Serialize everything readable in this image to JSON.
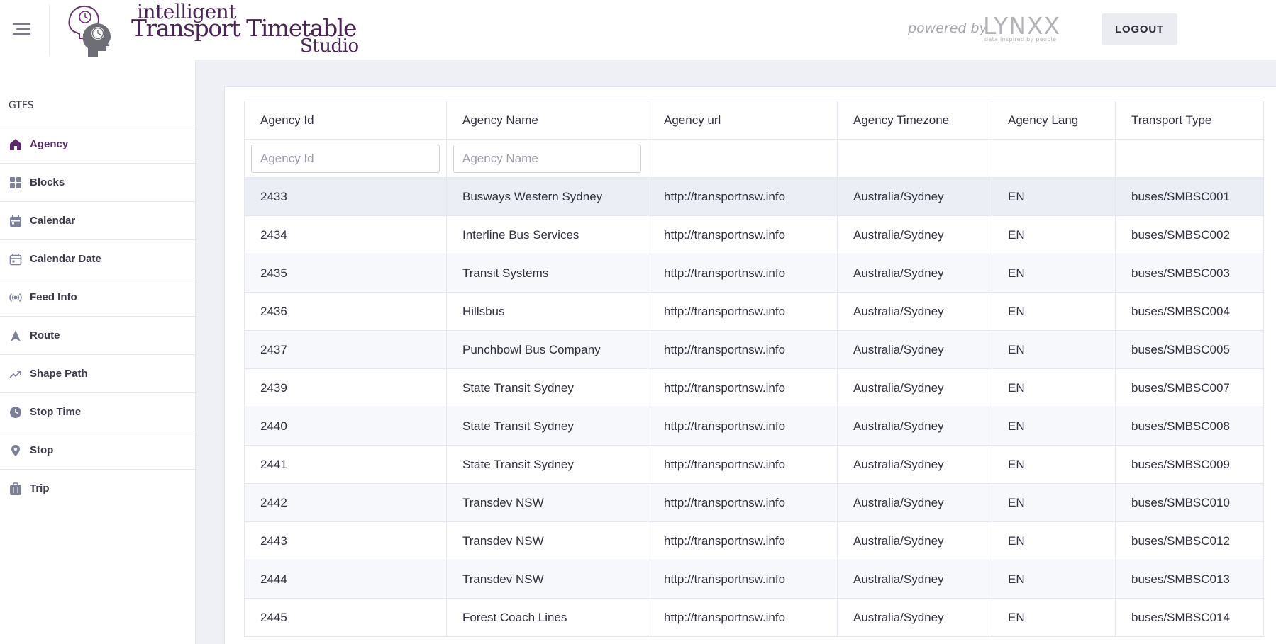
{
  "header": {
    "brand_line1": "intelligent",
    "brand_line2": "Transport Timetable",
    "brand_line3": "Studio",
    "powered_by": "powered by",
    "partner_logo": "LYNXX",
    "partner_tagline": "data inspired by people",
    "logout_label": "LOGOUT"
  },
  "sidebar": {
    "title": "GTFS",
    "items": [
      {
        "label": "Agency",
        "icon": "home-icon",
        "active": true
      },
      {
        "label": "Blocks",
        "icon": "grid-icon"
      },
      {
        "label": "Calendar",
        "icon": "calendar-icon"
      },
      {
        "label": "Calendar Date",
        "icon": "calendar-outline-icon"
      },
      {
        "label": "Feed Info",
        "icon": "broadcast-icon"
      },
      {
        "label": "Route",
        "icon": "navigation-arrow-icon"
      },
      {
        "label": "Shape Path",
        "icon": "trending-up-icon"
      },
      {
        "label": "Stop Time",
        "icon": "clock-icon"
      },
      {
        "label": "Stop",
        "icon": "map-pin-icon"
      },
      {
        "label": "Trip",
        "icon": "luggage-icon"
      }
    ]
  },
  "table": {
    "columns": [
      "Agency Id",
      "Agency Name",
      "Agency url",
      "Agency Timezone",
      "Agency Lang",
      "Transport Type"
    ],
    "filters": {
      "agency_id_placeholder": "Agency Id",
      "agency_name_placeholder": "Agency Name"
    },
    "rows": [
      [
        "2433",
        "Busways Western Sydney",
        "http://transportnsw.info",
        "Australia/Sydney",
        "EN",
        "buses/SMBSC001"
      ],
      [
        "2434",
        "Interline Bus Services",
        "http://transportnsw.info",
        "Australia/Sydney",
        "EN",
        "buses/SMBSC002"
      ],
      [
        "2435",
        "Transit Systems",
        "http://transportnsw.info",
        "Australia/Sydney",
        "EN",
        "buses/SMBSC003"
      ],
      [
        "2436",
        "Hillsbus",
        "http://transportnsw.info",
        "Australia/Sydney",
        "EN",
        "buses/SMBSC004"
      ],
      [
        "2437",
        "Punchbowl Bus Company",
        "http://transportnsw.info",
        "Australia/Sydney",
        "EN",
        "buses/SMBSC005"
      ],
      [
        "2439",
        "State Transit Sydney",
        "http://transportnsw.info",
        "Australia/Sydney",
        "EN",
        "buses/SMBSC007"
      ],
      [
        "2440",
        "State Transit Sydney",
        "http://transportnsw.info",
        "Australia/Sydney",
        "EN",
        "buses/SMBSC008"
      ],
      [
        "2441",
        "State Transit Sydney",
        "http://transportnsw.info",
        "Australia/Sydney",
        "EN",
        "buses/SMBSC009"
      ],
      [
        "2442",
        "Transdev NSW",
        "http://transportnsw.info",
        "Australia/Sydney",
        "EN",
        "buses/SMBSC010"
      ],
      [
        "2443",
        "Transdev NSW",
        "http://transportnsw.info",
        "Australia/Sydney",
        "EN",
        "buses/SMBSC012"
      ],
      [
        "2444",
        "Transdev NSW",
        "http://transportnsw.info",
        "Australia/Sydney",
        "EN",
        "buses/SMBSC013"
      ],
      [
        "2445",
        "Forest Coach Lines",
        "http://transportnsw.info",
        "Australia/Sydney",
        "EN",
        "buses/SMBSC014"
      ]
    ]
  },
  "colors": {
    "brand": "#4a2456",
    "active_nav": "#5a2a6e",
    "icon": "#7b7f99",
    "main_bg": "#eef0f6"
  }
}
